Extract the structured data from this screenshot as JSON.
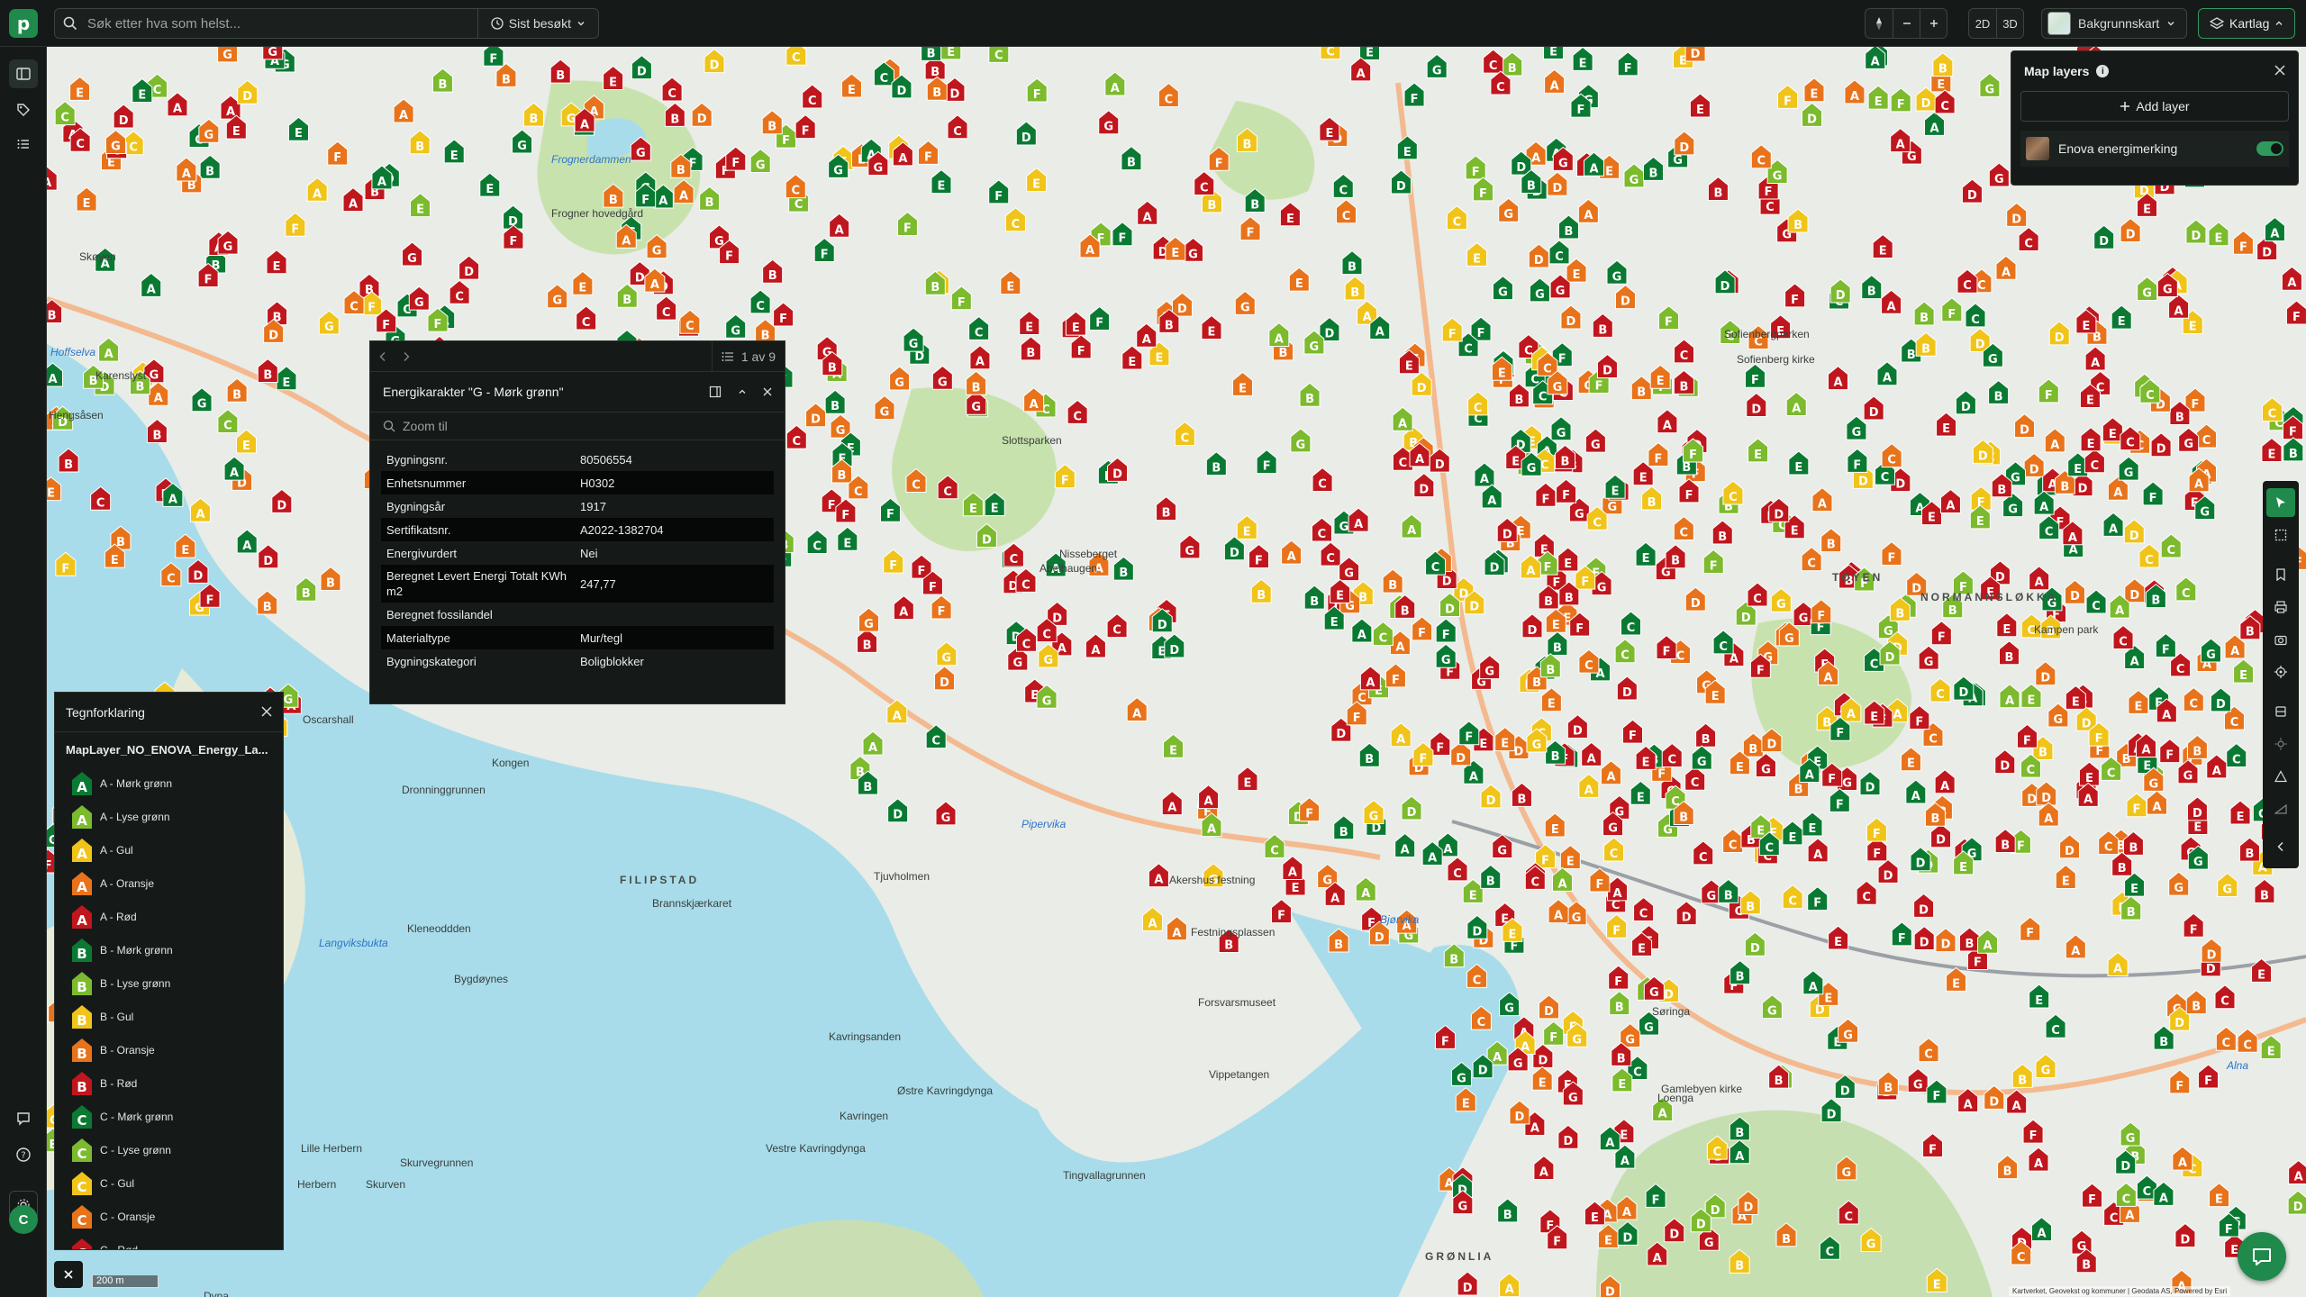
{
  "app": {
    "logo_letter": "p",
    "search_placeholder": "Søk etter hva som helst...",
    "recent_label": "Sist besøkt",
    "view_2d": "2D",
    "view_3d": "3D",
    "basemap_label": "Bakgrunnskart",
    "layers_button_label": "Kartlag",
    "avatar_initial": "C",
    "accent_color": "#1f8a4c"
  },
  "layers_panel": {
    "title": "Map layers",
    "add_label": "Add layer",
    "layers": [
      {
        "name": "Enova energimerking",
        "visible": true
      }
    ]
  },
  "popup": {
    "page_indicator": "1 av 9",
    "title": "Energikarakter \"G - Mørk grønn\"",
    "zoom_placeholder": "Zoom til",
    "attributes": [
      {
        "key": "Bygningsnr.",
        "value": "80506554"
      },
      {
        "key": "Enhetsnummer",
        "value": "H0302"
      },
      {
        "key": "Bygningsår",
        "value": "1917"
      },
      {
        "key": "Sertifikatsnr.",
        "value": "A2022-1382704"
      },
      {
        "key": "Energivurdert",
        "value": "Nei"
      },
      {
        "key": "Beregnet Levert Energi Totalt KWh m2",
        "value": "247,77"
      },
      {
        "key": "Beregnet fossilandel",
        "value": ""
      },
      {
        "key": "Materialtype",
        "value": "Mur/tegl"
      },
      {
        "key": "Bygningskategori",
        "value": "Boligblokker"
      }
    ]
  },
  "legend": {
    "title": "Tegnforklaring",
    "layer_name": "MapLayer_NO_ENOVA_Energy_La...",
    "items": [
      {
        "letter": "A",
        "label": "A - Mørk grønn",
        "color": "#0a7a33"
      },
      {
        "letter": "A",
        "label": "A - Lyse grønn",
        "color": "#7cba2e"
      },
      {
        "letter": "A",
        "label": "A - Gul",
        "color": "#f0c419"
      },
      {
        "letter": "A",
        "label": "A - Oransje",
        "color": "#e8731b"
      },
      {
        "letter": "A",
        "label": "A - Rød",
        "color": "#c0161d"
      },
      {
        "letter": "B",
        "label": "B - Mørk grønn",
        "color": "#0a7a33"
      },
      {
        "letter": "B",
        "label": "B - Lyse grønn",
        "color": "#7cba2e"
      },
      {
        "letter": "B",
        "label": "B - Gul",
        "color": "#f0c419"
      },
      {
        "letter": "B",
        "label": "B - Oransje",
        "color": "#e8731b"
      },
      {
        "letter": "B",
        "label": "B - Rød",
        "color": "#c0161d"
      },
      {
        "letter": "C",
        "label": "C - Mørk grønn",
        "color": "#0a7a33"
      },
      {
        "letter": "C",
        "label": "C - Lyse grønn",
        "color": "#7cba2e"
      },
      {
        "letter": "C",
        "label": "C - Gul",
        "color": "#f0c419"
      },
      {
        "letter": "C",
        "label": "C - Oransje",
        "color": "#e8731b"
      },
      {
        "letter": "C",
        "label": "C - Rød",
        "color": "#c0161d"
      }
    ]
  },
  "map": {
    "scale_label": "200 m",
    "attribution": "Kartverket, Geovekst og kommuner | Geodata AS, Powered by Esri",
    "place_labels": [
      {
        "text": "Frognerdammen",
        "type": "water"
      },
      {
        "text": "Frogner hovedgård",
        "type": "place"
      },
      {
        "text": "Skøyen",
        "type": "place"
      },
      {
        "text": "Hoffselva",
        "type": "water"
      },
      {
        "text": "Karenslyst",
        "type": "place"
      },
      {
        "text": "Hengsåsen",
        "type": "place"
      },
      {
        "text": "Oscarshall",
        "type": "place"
      },
      {
        "text": "Kongen",
        "type": "place"
      },
      {
        "text": "Dronninggrunnen",
        "type": "place"
      },
      {
        "text": "FILIPSTAD",
        "type": "district"
      },
      {
        "text": "Bygdøynes",
        "type": "place"
      },
      {
        "text": "Langviksbukta",
        "type": "water"
      },
      {
        "text": "Kavringsanden",
        "type": "place"
      },
      {
        "text": "Østre Kavringdynga",
        "type": "place"
      },
      {
        "text": "Vestre Kavringdynga",
        "type": "place"
      },
      {
        "text": "Kavringen",
        "type": "place"
      },
      {
        "text": "Tingvallagrunnen",
        "type": "place"
      },
      {
        "text": "Lille Herbern",
        "type": "place"
      },
      {
        "text": "Herbern",
        "type": "place"
      },
      {
        "text": "Skurven",
        "type": "place"
      },
      {
        "text": "Skurvegrunnen",
        "type": "place"
      },
      {
        "text": "Dyna",
        "type": "place"
      },
      {
        "text": "Akershus festning",
        "type": "place"
      },
      {
        "text": "Festningsplassen",
        "type": "place"
      },
      {
        "text": "Forsvarsmuseet",
        "type": "place"
      },
      {
        "text": "Pipervika",
        "type": "water"
      },
      {
        "text": "Bjørvika",
        "type": "water"
      },
      {
        "text": "TØYEN",
        "type": "district"
      },
      {
        "text": "NORMANNSLØKKA",
        "type": "district"
      },
      {
        "text": "GRØNLIA",
        "type": "district"
      },
      {
        "text": "Alna",
        "type": "water"
      },
      {
        "text": "Søringa",
        "type": "place"
      },
      {
        "text": "Loenga",
        "type": "place"
      },
      {
        "text": "Gamlebyen kirke",
        "type": "place"
      },
      {
        "text": "Slottsparken",
        "type": "place"
      },
      {
        "text": "Nisseberget",
        "type": "place"
      },
      {
        "text": "Abelhaugen",
        "type": "place"
      },
      {
        "text": "Sofienbergparken",
        "type": "place"
      },
      {
        "text": "Sofienberg kirke",
        "type": "place"
      },
      {
        "text": "Kampen park",
        "type": "place"
      },
      {
        "text": "Kleneoddden",
        "type": "place"
      },
      {
        "text": "Brannskjærkaret",
        "type": "place"
      },
      {
        "text": "Tjuvholmen",
        "type": "place"
      },
      {
        "text": "Vippetangen",
        "type": "place"
      }
    ]
  }
}
